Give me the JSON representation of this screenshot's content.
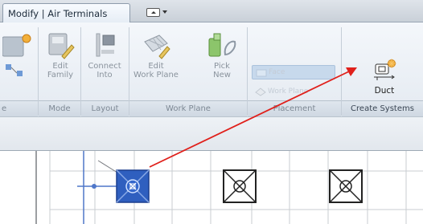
{
  "tabs": {
    "active_label": "Modify | Air Terminals",
    "dropdown_icon": "panel-toggle-icon"
  },
  "ribbon": {
    "tools": {
      "edit_family": "Edit\nFamily",
      "connect_into": "Connect\nInto",
      "edit_work_plane": "Edit\nWork Plane",
      "pick_new": "Pick\nNew",
      "face": "Face",
      "work_plane": "Work Plane",
      "duct": "Duct"
    },
    "panels": {
      "left_partial": "e",
      "mode": "Mode",
      "layout": "Layout",
      "work_plane": "Work Plane",
      "placement": "Placement",
      "create_systems": "Create Systems"
    }
  },
  "colors": {
    "selected_terminal": "#2f5fbf",
    "arrow": "#e0201b",
    "grid": "#c9ccd0"
  }
}
